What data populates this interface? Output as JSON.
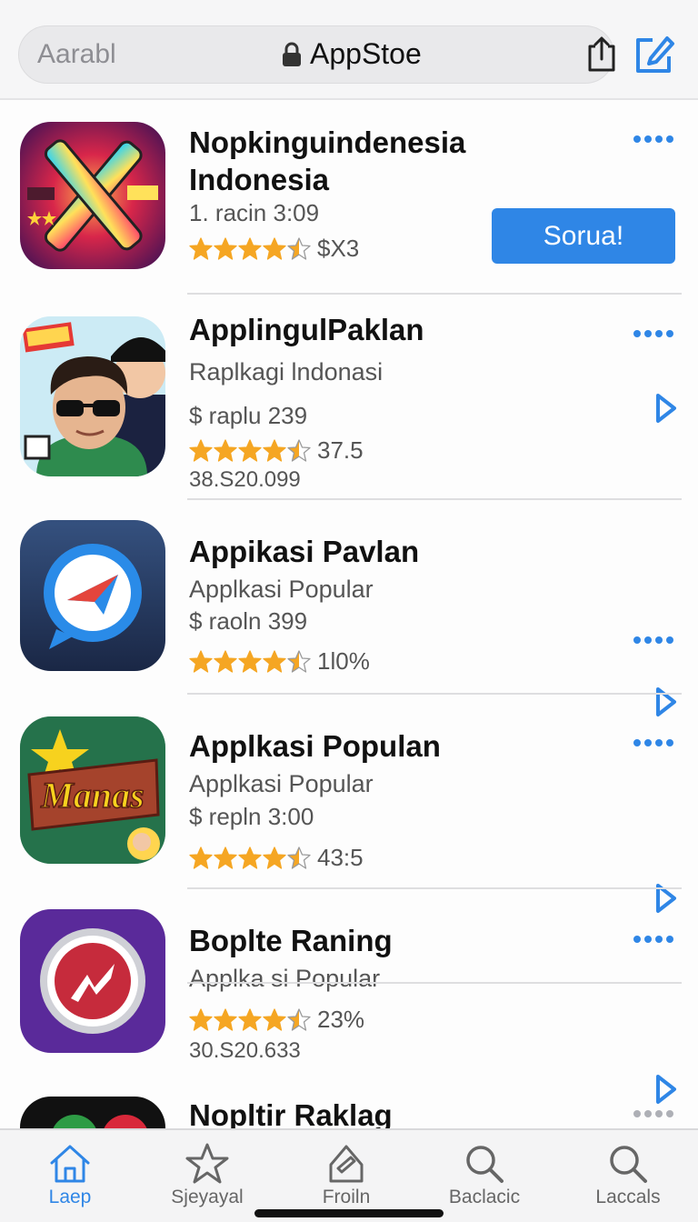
{
  "header": {
    "left_text": "Aarabl",
    "title": "AppStoe"
  },
  "apps": [
    {
      "name_line1": "Nopkinguindenesia",
      "name_line2": "Indonesia",
      "meta": "1. racin 3:09",
      "rating_text": "$X3",
      "rating": 4.5,
      "button_label": "Sorua!"
    },
    {
      "name": "ApplingulPaklan",
      "subtitle": "Raplkagi lndonasi",
      "price": "$ raplu 239",
      "rating_text": "37.5",
      "rating": 4.5,
      "extra": "38.S20.099"
    },
    {
      "name": "Appikasi Pavlan",
      "subtitle": "Applkasi Popular",
      "price": "$ raoln 399",
      "rating_text": "1l0%",
      "rating": 4.5
    },
    {
      "name": "Applkasi Populan",
      "subtitle": "Applkasi Popular",
      "price": "$ repln 3:00",
      "rating_text": "43:5",
      "rating": 4.5,
      "icon_text": "Manas"
    },
    {
      "name": "Boplte Raning",
      "subtitle": "Applka si Popular",
      "rating_text": "23%",
      "rating": 4.5,
      "extra": "30.S20.633"
    },
    {
      "name": "Nopltir Raklag"
    }
  ],
  "tabs": [
    {
      "label": "Laep",
      "icon": "home-icon",
      "active": true
    },
    {
      "label": "Sjeyayal",
      "icon": "star-icon",
      "active": false
    },
    {
      "label": "Froiln",
      "icon": "apps-icon",
      "active": false
    },
    {
      "label": "Baclacic",
      "icon": "search-icon",
      "active": false
    },
    {
      "label": "Laccals",
      "icon": "search-icon",
      "active": false
    }
  ],
  "colors": {
    "accent": "#2f86e6",
    "star": "#f5a623",
    "divider": "#dedee0"
  }
}
